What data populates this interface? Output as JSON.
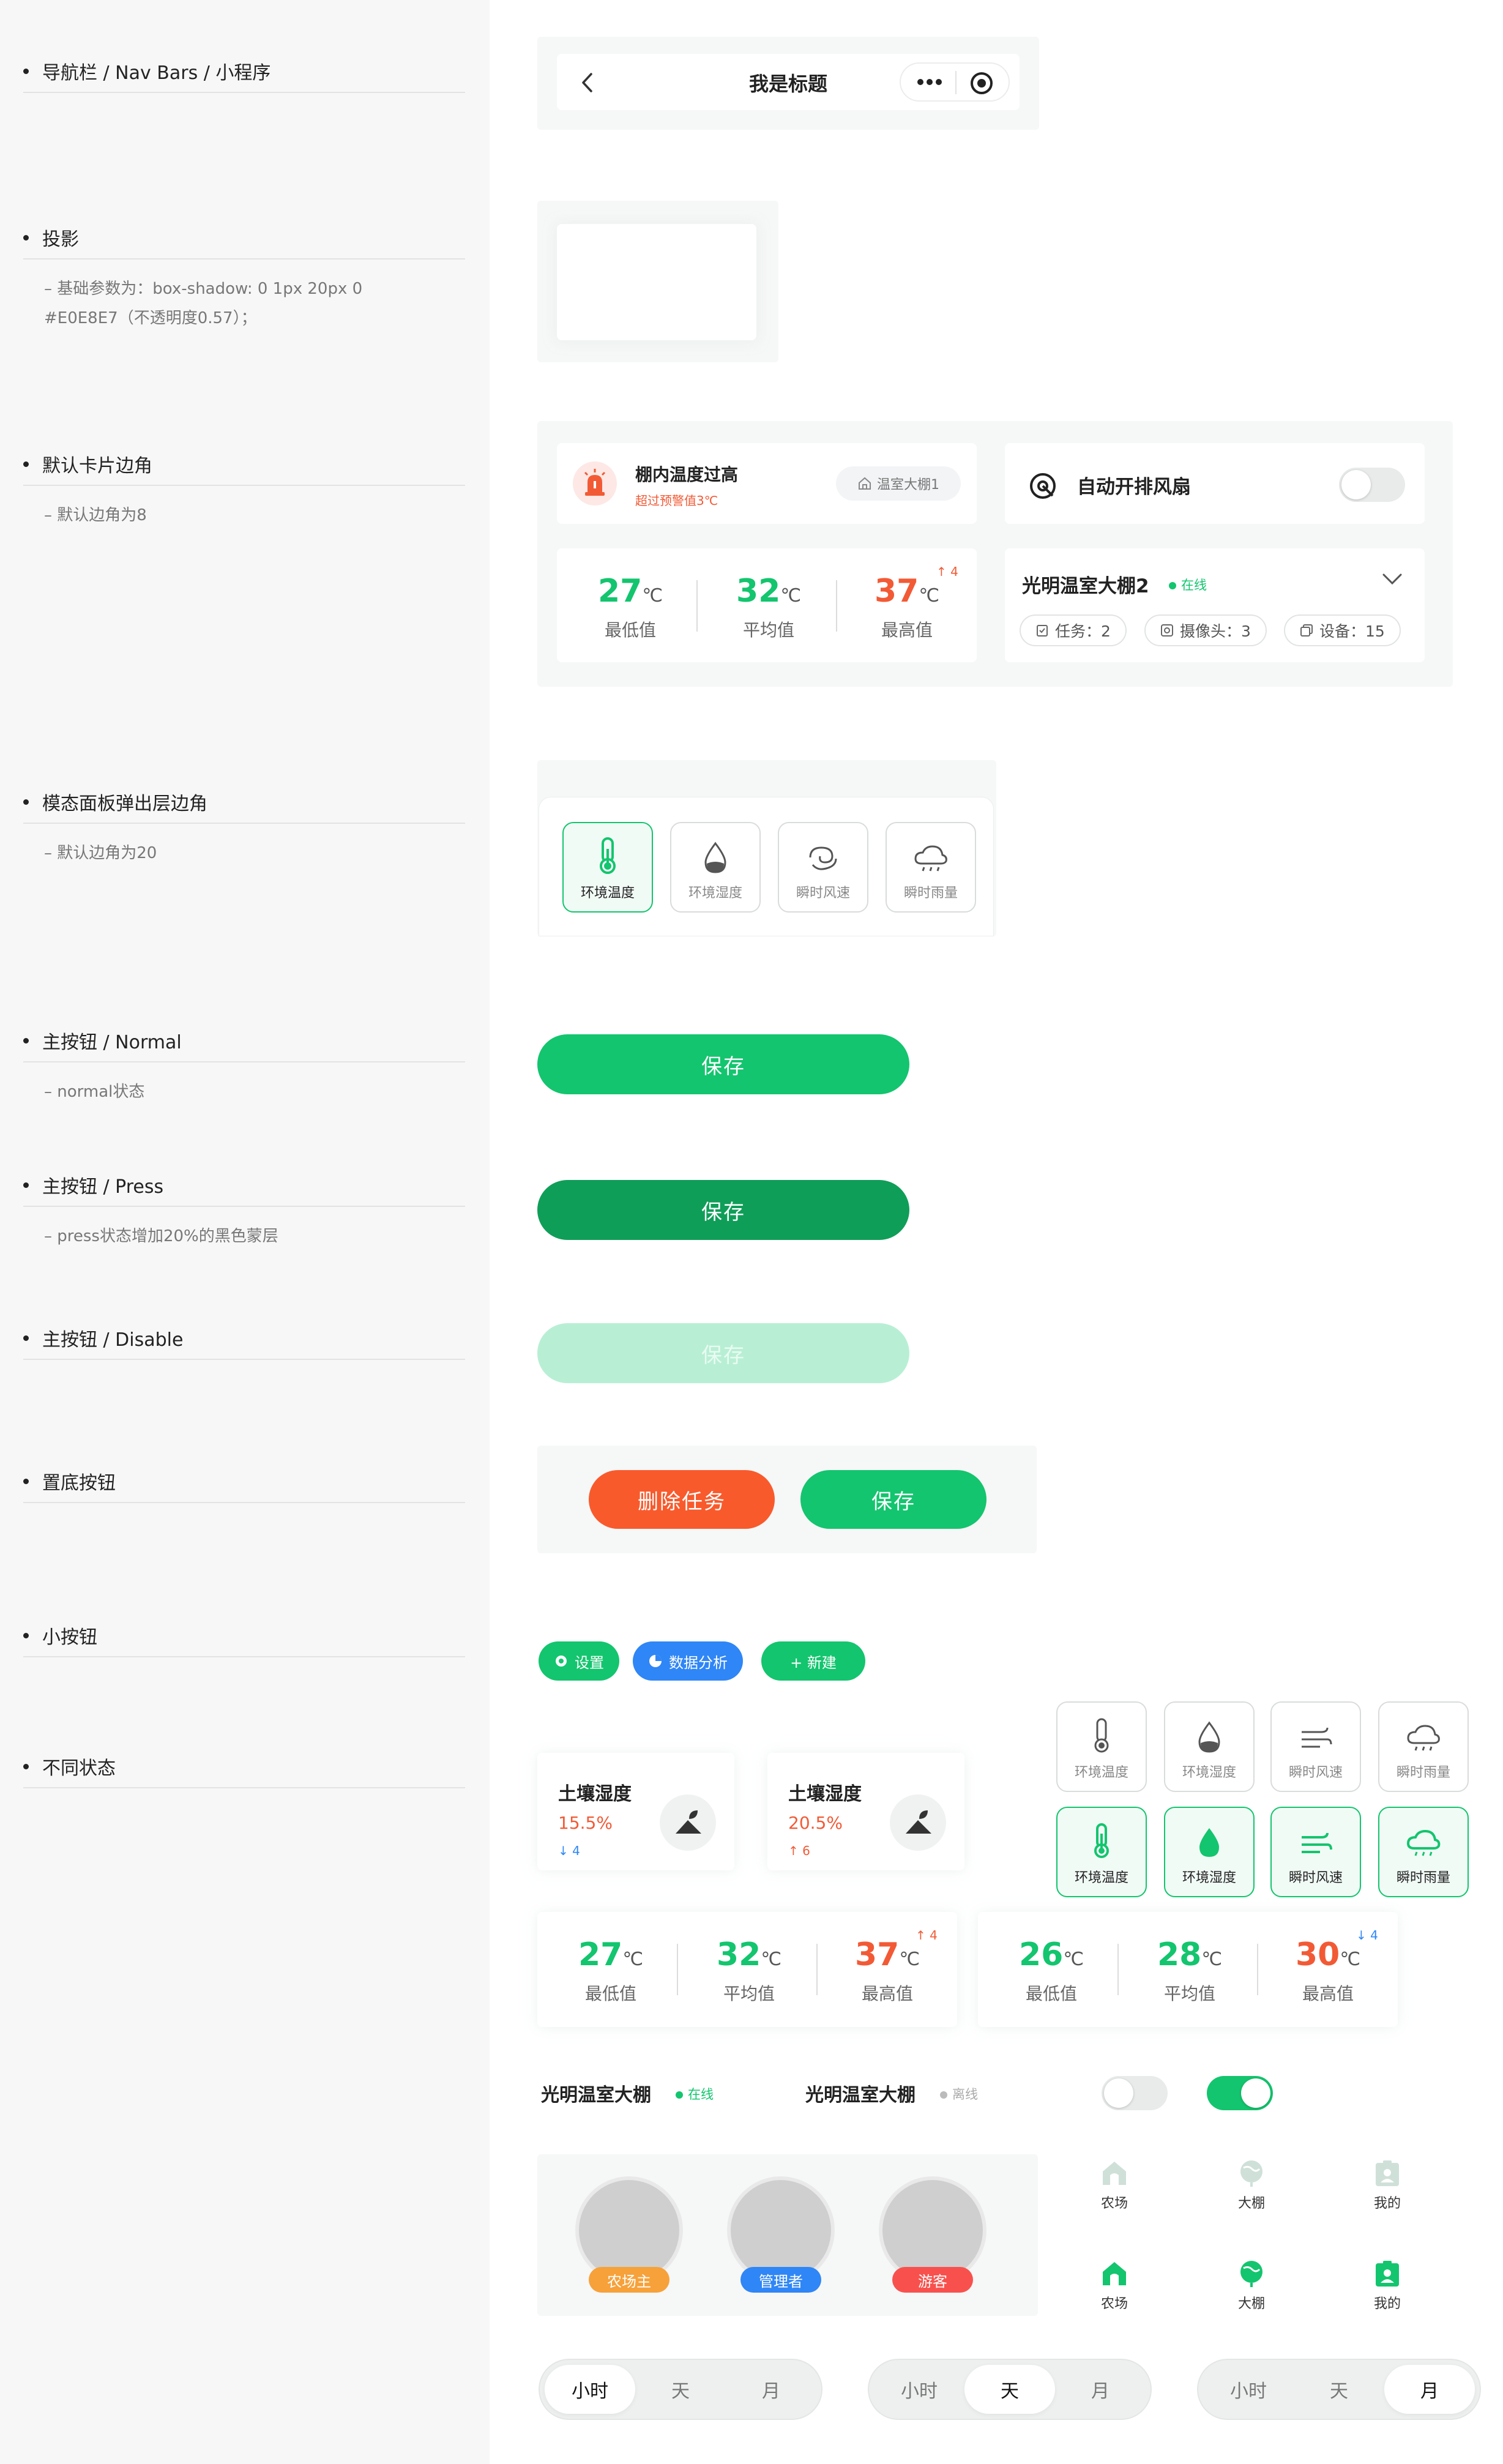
{
  "sidebar": {
    "sections": [
      {
        "title": "导航栏 / Nav Bars / 小程序",
        "desc": ""
      },
      {
        "title": "投影",
        "desc": "– 基础参数为：box-shadow: 0 1px 20px 0\n#E0E8E7（不透明度0.57）；"
      },
      {
        "title": "默认卡片边角",
        "desc": "– 默认边角为8"
      },
      {
        "title": "模态面板弹出层边角",
        "desc": "– 默认边角为20"
      },
      {
        "title": "主按钮 / Normal",
        "desc": "– normal状态"
      },
      {
        "title": "主按钮 / Press",
        "desc": "– press状态增加20%的黑色蒙层"
      },
      {
        "title": "主按钮 / Disable",
        "desc": ""
      },
      {
        "title": "置底按钮",
        "desc": ""
      },
      {
        "title": "小按钮",
        "desc": ""
      },
      {
        "title": "不同状态",
        "desc": ""
      }
    ]
  },
  "navbar": {
    "title": "我是标题",
    "back_icon": "chevron-left-icon",
    "more_icon": "more-dots-icon",
    "close_icon": "target-circle-icon"
  },
  "alert_card": {
    "title": "棚内温度过高",
    "subtitle": "超过预警值3℃",
    "tag": "温室大棚1"
  },
  "fan_card": {
    "title": "自动开排风扇"
  },
  "temp_card": {
    "min": "27",
    "avg": "32",
    "max": "37",
    "unit": "℃",
    "min_label": "最低值",
    "avg_label": "平均值",
    "max_label": "最高值",
    "delta": "4"
  },
  "greenhouse_card": {
    "name": "光明温室大棚2",
    "status": "在线",
    "tasks": "任务：2",
    "cameras": "摄像头：3",
    "devices": "设备：15"
  },
  "modal_tiles": [
    "环境温度",
    "环境湿度",
    "瞬时风速",
    "瞬时雨量"
  ],
  "buttons": {
    "save": "保存",
    "delete": "删除任务"
  },
  "small_buttons": {
    "settings": "设置",
    "analysis": "数据分析",
    "new": "+ 新建"
  },
  "soil_cards": [
    {
      "title": "土壤湿度",
      "value": "15.5%",
      "delta": "4",
      "dir": "down"
    },
    {
      "title": "土壤湿度",
      "value": "20.5%",
      "delta": "6",
      "dir": "up"
    }
  ],
  "state_tiles": [
    "环境温度",
    "环境湿度",
    "瞬时风速",
    "瞬时雨量"
  ],
  "temp_cards2": [
    {
      "min": "27",
      "avg": "32",
      "max": "37",
      "delta": "4",
      "dir": "up"
    },
    {
      "min": "26",
      "avg": "28",
      "max": "30",
      "delta": "4",
      "dir": "down"
    }
  ],
  "status_rows": [
    {
      "name": "光明温室大棚",
      "status": "在线"
    },
    {
      "name": "光明温室大棚",
      "status": "离线"
    }
  ],
  "roles": [
    "农场主",
    "管理者",
    "游客"
  ],
  "tabbar": [
    "农场",
    "大棚",
    "我的"
  ],
  "segments": [
    "小时",
    "天",
    "月"
  ],
  "colors": {
    "primary": "#13C56E",
    "press": "#0F9E58",
    "disabled": "#B8EFD4",
    "danger": "#F95A2C",
    "blue": "#2F86F6",
    "orange": "#F7A13A",
    "pink": "#F8514D"
  }
}
